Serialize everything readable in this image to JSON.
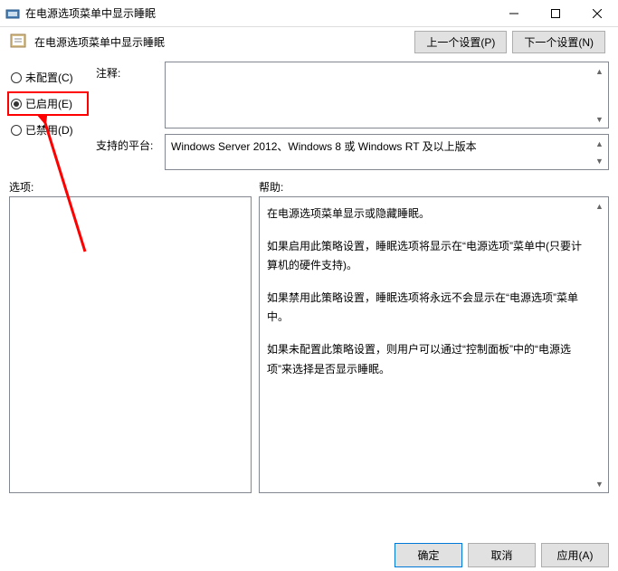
{
  "titlebar": {
    "title": "在电源选项菜单中显示睡眠"
  },
  "subheader": {
    "title": "在电源选项菜单中显示睡眠"
  },
  "nav": {
    "prev": "上一个设置(P)",
    "next": "下一个设置(N)"
  },
  "radios": {
    "unconfigured": "未配置(C)",
    "enabled": "已启用(E)",
    "disabled": "已禁用(D)",
    "selected": "enabled"
  },
  "labels": {
    "comment": "注释:",
    "supported": "支持的平台:",
    "options": "选项:",
    "help": "帮助:"
  },
  "supported_text": "Windows Server 2012、Windows 8 或 Windows RT 及以上版本",
  "help_paragraphs": [
    "在电源选项菜单显示或隐藏睡眠。",
    "如果启用此策略设置，睡眠选项将显示在“电源选项”菜单中(只要计算机的硬件支持)。",
    "如果禁用此策略设置，睡眠选项将永远不会显示在“电源选项”菜单中。",
    "如果未配置此策略设置，则用户可以通过“控制面板”中的“电源选项”来选择是否显示睡眠。"
  ],
  "footer": {
    "ok": "确定",
    "cancel": "取消",
    "apply": "应用(A)"
  }
}
